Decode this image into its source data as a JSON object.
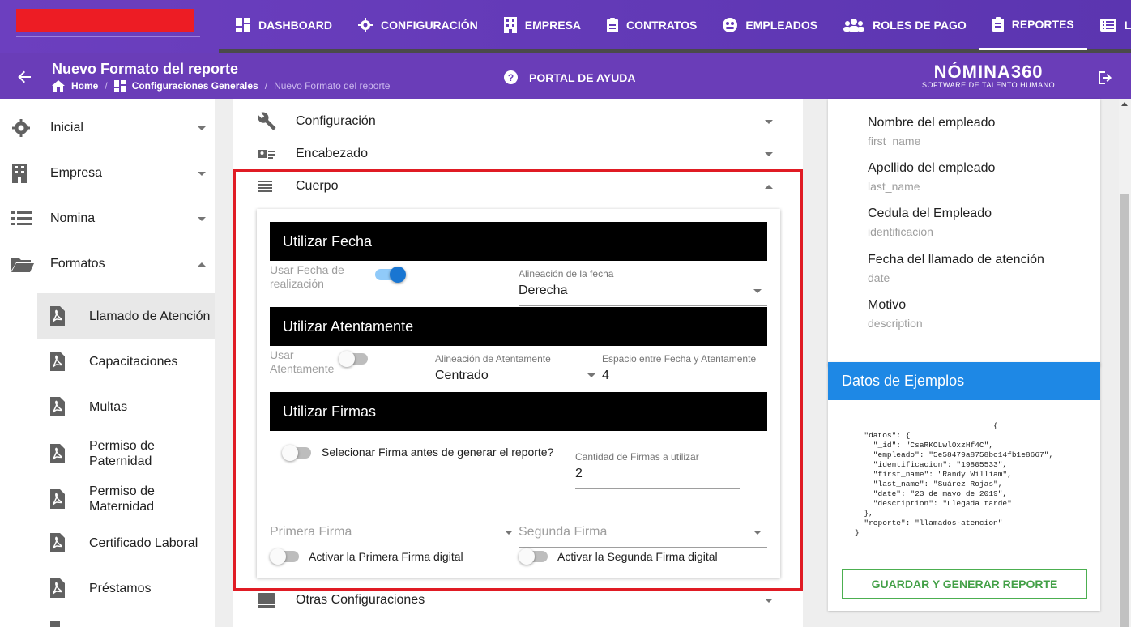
{
  "nav": {
    "items": [
      {
        "label": "DASHBOARD",
        "icon": "dashboard-icon"
      },
      {
        "label": "CONFIGURACIÓN",
        "icon": "gear-icon"
      },
      {
        "label": "EMPRESA",
        "icon": "building-icon"
      },
      {
        "label": "CONTRATOS",
        "icon": "clipboard-icon"
      },
      {
        "label": "EMPLEADOS",
        "icon": "employees-icon"
      },
      {
        "label": "ROLES DE PAGO",
        "icon": "users-icon"
      },
      {
        "label": "REPORTES",
        "icon": "clipboard-list-icon"
      },
      {
        "label": "LIQU",
        "icon": "list-icon"
      }
    ],
    "active": "REPORTES"
  },
  "header": {
    "title": "Nuevo Formato del reporte",
    "breadcrumb": [
      "Home",
      "Configuraciones Generales",
      "Nuevo Formato del reporte"
    ],
    "help": "PORTAL DE AYUDA",
    "brand": "NÓMINA360",
    "brand_sub": "SOFTWARE DE TALENTO HUMANO"
  },
  "sidebar": {
    "items": [
      {
        "label": "Inicial",
        "icon": "gear-icon"
      },
      {
        "label": "Empresa",
        "icon": "building-icon"
      },
      {
        "label": "Nomina",
        "icon": "list-icon"
      },
      {
        "label": "Formatos",
        "icon": "folder-open-icon"
      }
    ],
    "formatos": [
      {
        "label": "Llamado de Atención"
      },
      {
        "label": "Capacitaciones"
      },
      {
        "label": "Multas"
      },
      {
        "label": "Permiso de Paternidad"
      },
      {
        "label": "Permiso de Maternidad"
      },
      {
        "label": "Certificado Laboral"
      },
      {
        "label": "Préstamos"
      }
    ]
  },
  "sections": {
    "configuracion": "Configuración",
    "encabezado": "Encabezado",
    "cuerpo": "Cuerpo",
    "otras": "Otras Configuraciones"
  },
  "cuerpo": {
    "fecha": {
      "header": "Utilizar Fecha",
      "toggle_label": "Usar Fecha de realización",
      "toggle_on": true,
      "align_label": "Alineación de la fecha",
      "align_value": "Derecha"
    },
    "atentamente": {
      "header": "Utilizar Atentamente",
      "toggle_label": "Usar Atentamente",
      "toggle_on": false,
      "align_label": "Alineación de Atentamente",
      "align_value": "Centrado",
      "space_label": "Espacio entre Fecha y Atentamente",
      "space_value": "4"
    },
    "firmas": {
      "header": "Utilizar Firmas",
      "select_label": "Selecionar Firma antes de generar el reporte?",
      "qty_label": "Cantidad de Firmas a utilizar",
      "qty_value": "2",
      "first_placeholder": "Primera Firma",
      "second_placeholder": "Segunda Firma",
      "first_digital": "Activar la Primera Firma digital",
      "second_digital": "Activar la Segunda Firma digital"
    }
  },
  "variables": [
    {
      "name": "Nombre del empleado",
      "key": "first_name"
    },
    {
      "name": "Apellido del empleado",
      "key": "last_name"
    },
    {
      "name": "Cedula del Empleado",
      "key": "identificacion"
    },
    {
      "name": "Fecha del llamado de atención",
      "key": "date"
    },
    {
      "name": "Motivo",
      "key": "description"
    }
  ],
  "examples": {
    "title": "Datos de Ejemplos",
    "json_text": "                              {\n  \"datos\": {\n    \"_id\": \"CsaRKOLwl0xzHf4C\",\n    \"empleado\": \"5e58479a8758bc14fb1e8667\",\n    \"identificacion\": \"19805533\",\n    \"first_name\": \"Randy William\",\n    \"last_name\": \"Suárez Rojas\",\n    \"date\": \"23 de mayo de 2019\",\n    \"description\": \"Llegada tarde\"\n  },\n  \"reporte\": \"llamados-atencion\"\n}",
    "save_label": "GUARDAR Y GENERAR REPORTE"
  },
  "colors": {
    "primary": "#6a3db8",
    "accent_blue": "#1e88e5",
    "highlight": "#e01b24",
    "save": "#43a047"
  }
}
